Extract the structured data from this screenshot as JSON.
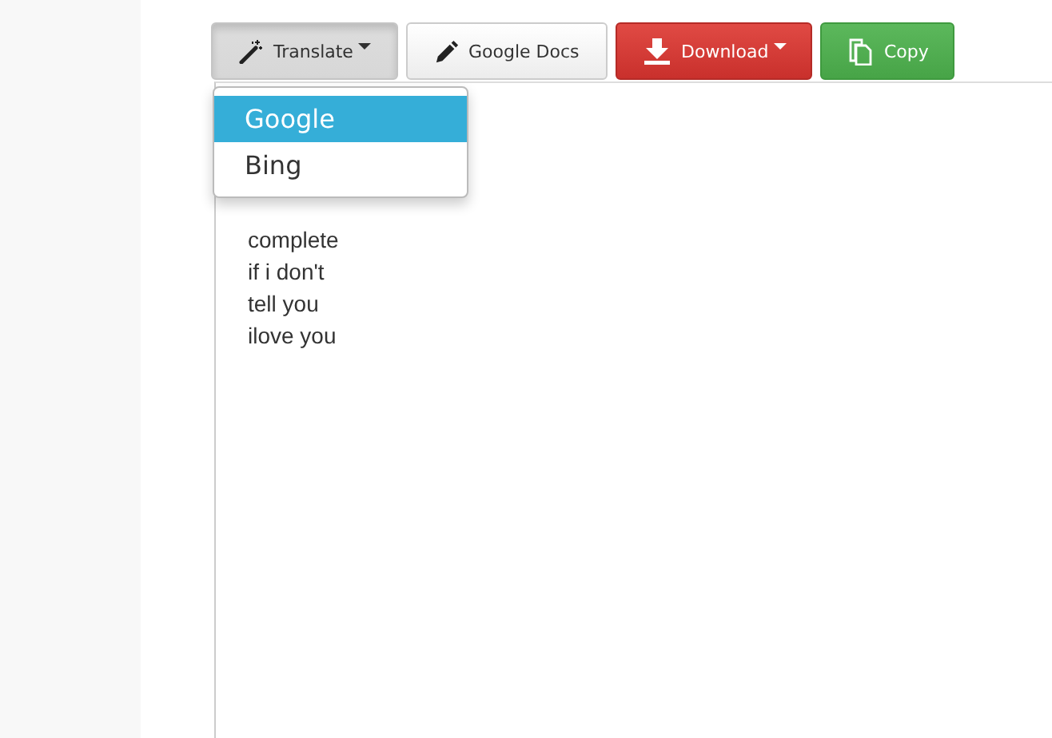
{
  "toolbar": [
    {
      "kind": "translate",
      "label": "Translate",
      "caret": true,
      "active": true
    },
    {
      "kind": "docs",
      "label": "Google Docs",
      "caret": false,
      "active": false
    },
    {
      "kind": "download",
      "label": "Download",
      "caret": true,
      "active": false
    },
    {
      "kind": "copy",
      "label": "Copy",
      "caret": false,
      "active": false
    }
  ],
  "menu": [
    {
      "label": "Google",
      "selected": true
    },
    {
      "label": "Bing",
      "selected": false
    }
  ],
  "text_lines": [
    "complete",
    "if i don't",
    "tell you",
    "ilove you"
  ]
}
